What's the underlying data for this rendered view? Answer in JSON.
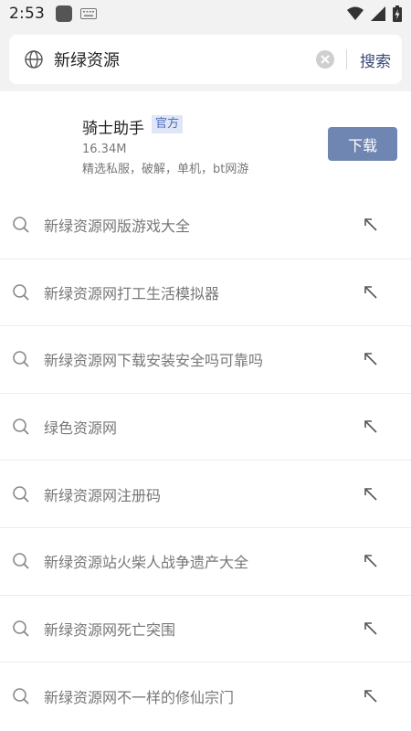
{
  "status_bar": {
    "time": "2:53",
    "icons": [
      "app-icon",
      "keyboard-icon",
      "wifi-icon",
      "cellular-signal-icon",
      "battery-charging-icon"
    ]
  },
  "search": {
    "query": "新绿资源",
    "submit_label": "搜索",
    "leading_icon": "globe-icon",
    "clear_icon": "clear-icon"
  },
  "app_card": {
    "name": "骑士助手",
    "badge": "官方",
    "size": "16.34M",
    "description": "精选私服，破解，单机，bt网游",
    "download_label": "下载",
    "colors": {
      "download_bg": "#6f86b2",
      "badge_bg": "#dfe7f7",
      "badge_text": "#4a6cb8"
    }
  },
  "suggestions": [
    {
      "text": "新绿资源网版游戏大全"
    },
    {
      "text": "新绿资源网打工生活模拟器"
    },
    {
      "text": "新绿资源网下载安装安全吗可靠吗"
    },
    {
      "text": "绿色资源网"
    },
    {
      "text": "新绿资源网注册码"
    },
    {
      "text": "新绿资源站火柴人战争遗产大全"
    },
    {
      "text": "新绿资源网死亡突围"
    },
    {
      "text": "新绿资源网不一样的修仙宗门"
    }
  ]
}
